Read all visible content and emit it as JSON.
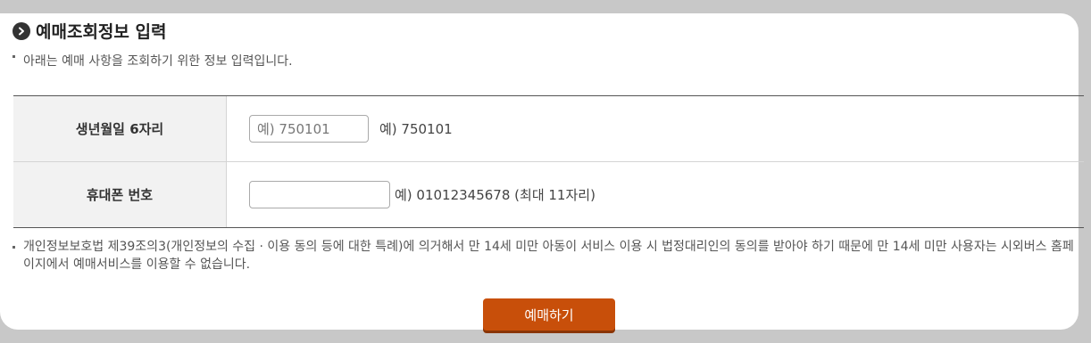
{
  "header": {
    "title": "예매조회정보 입력",
    "description": "아래는 예매 사항을 조회하기 위한 정보 입력입니다."
  },
  "form": {
    "birth": {
      "label": "생년월일 6자리",
      "placeholder": "예) 750101",
      "value": "",
      "hint": "예) 750101"
    },
    "phone": {
      "label": "휴대폰 번호",
      "placeholder": "",
      "value": "",
      "hint": "예) 01012345678 (최대 11자리)"
    }
  },
  "notice": "개인정보보호법 제39조의3(개인정보의 수집 · 이용 동의 등에 대한 특례)에 의거해서 만 14세 미만 아동이 서비스 이용 시 법정대리인의 동의를 받아야 하기 때문에 만 14세 미만 사용자는 시외버스 홈페이지에서 예매서비스를 이용할 수 없습니다.",
  "submit_label": "예매하기",
  "colors": {
    "accent": "#c84f0a",
    "background": "#c8c8c8",
    "label_bg": "#f2f2f2"
  },
  "icons": {
    "title_icon": "chevron-right-circle-icon"
  }
}
